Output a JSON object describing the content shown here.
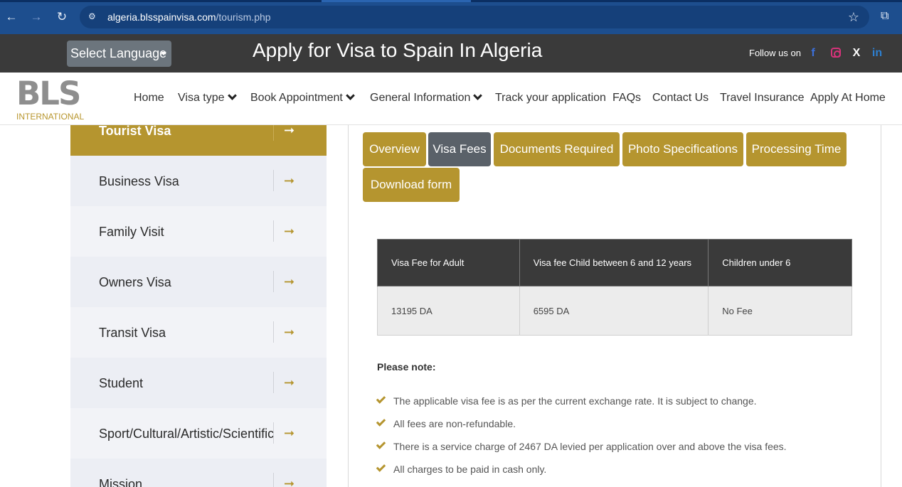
{
  "browser": {
    "url_domain": "algeria.blsspainvisa.com",
    "url_path": "/tourism.php"
  },
  "header": {
    "language_label": "Select Language",
    "title": "Apply for Visa to Spain In Algeria",
    "follow_label": "Follow us on",
    "social": [
      "f",
      "X",
      "in"
    ]
  },
  "logo": {
    "brand": "BLS",
    "sub": "INTERNATIONAL"
  },
  "nav": {
    "home": "Home",
    "visa_type": "Visa type",
    "book_appointment": "Book Appointment",
    "general_information": "General Information",
    "track": "Track your application",
    "faqs": "FAQs",
    "contact": "Contact Us",
    "insurance": "Travel Insurance",
    "apply_home": "Apply At Home"
  },
  "sidebar": {
    "arrow": "➞",
    "items": [
      {
        "label": "Tourist Visa"
      },
      {
        "label": "Business Visa"
      },
      {
        "label": "Family Visit"
      },
      {
        "label": "Owners Visa"
      },
      {
        "label": "Transit Visa"
      },
      {
        "label": "Student"
      },
      {
        "label": "Sport/Cultural/Artistic/Scientific"
      },
      {
        "label": "Mission"
      }
    ]
  },
  "tabs": {
    "overview": "Overview",
    "visa_fees": "Visa Fees",
    "documents": "Documents Required",
    "photo": "Photo Specifications",
    "processing": "Processing Time",
    "download": "Download form"
  },
  "fees": {
    "headers": [
      "Visa Fee for Adult",
      "Visa fee Child between 6 and 12 years",
      "Children under 6"
    ],
    "values": [
      "13195 DA",
      "6595 DA",
      "No Fee"
    ]
  },
  "notes": {
    "heading": "Please note:",
    "items": [
      "The applicable visa fee is as per the current exchange rate. It is subject to change.",
      "All fees are non-refundable.",
      "There is a service charge of 2467 DA levied per application over and above the visa fees.",
      "All charges to be paid in cash only."
    ]
  },
  "colors": {
    "accent": "#b5952f",
    "chrome": "#1d4e8e",
    "header": "#3a3a3a",
    "selected_tab": "#5a6169"
  }
}
